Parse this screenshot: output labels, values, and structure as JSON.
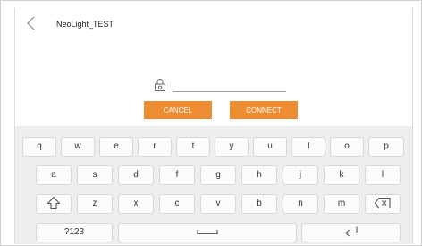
{
  "header": {
    "back_icon": "chevron-left-icon",
    "title": "NeoLight_TEST"
  },
  "password": {
    "icon": "lock-icon",
    "value": "",
    "placeholder": ""
  },
  "buttons": {
    "cancel_label": "CANCEL",
    "connect_label": "CONNECT"
  },
  "colors": {
    "accent": "#ee8c32",
    "keyboard_bg": "#eeeeee",
    "key_bg": "#fbfbfb"
  },
  "keyboard": {
    "row1": [
      "q",
      "w",
      "e",
      "r",
      "t",
      "y",
      "u",
      "I",
      "o",
      "p"
    ],
    "row2": [
      "a",
      "s",
      "d",
      "f",
      "g",
      "h",
      "j",
      "k",
      "l"
    ],
    "row3": [
      "z",
      "x",
      "c",
      "v",
      "b",
      "n",
      "m"
    ],
    "shift_icon": "shift-arrow-icon",
    "backspace_icon": "backspace-icon",
    "symbols_label": "?123",
    "space_icon": "space-bar-icon",
    "enter_icon": "enter-return-icon"
  }
}
